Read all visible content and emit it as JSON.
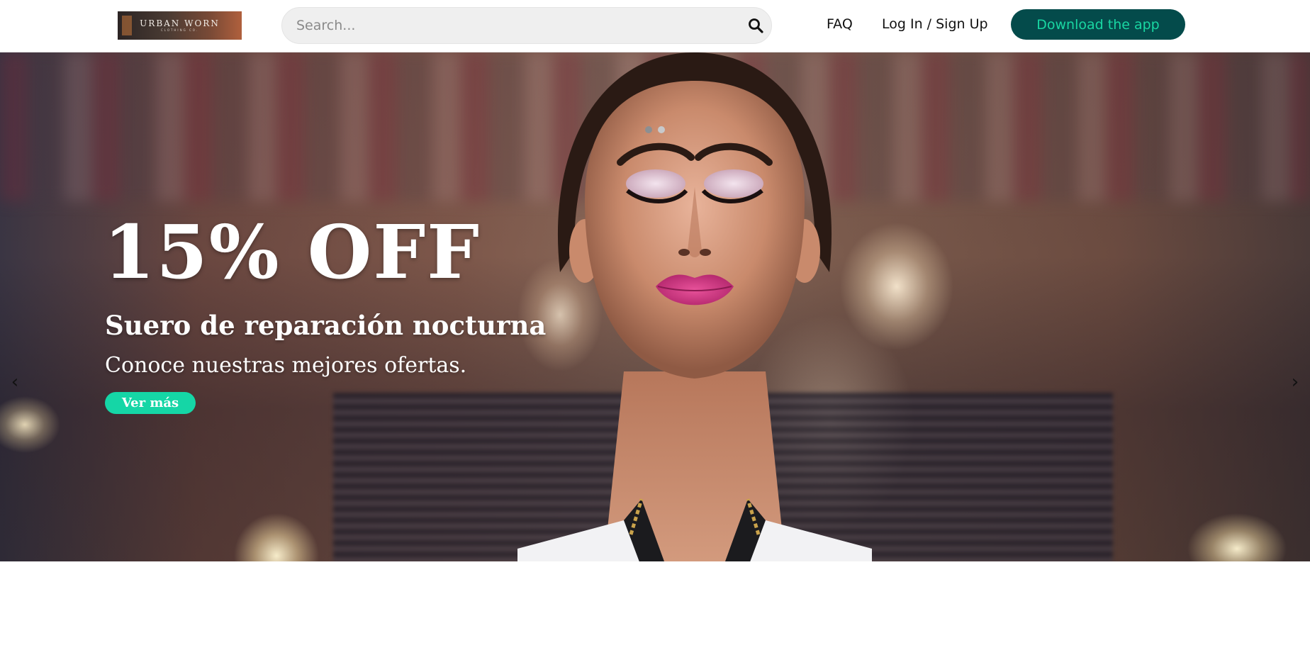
{
  "header": {
    "logo": {
      "text": "URBAN WORN",
      "subtext": "CLOTHING CO."
    },
    "search": {
      "placeholder": "Search...",
      "value": "",
      "icon": "search-icon"
    },
    "nav": {
      "faq_label": "FAQ",
      "login_label": "Log In / Sign Up"
    },
    "download_label": "Download the app",
    "colors": {
      "download_bg": "#044b4b",
      "download_text": "#19d6a2"
    }
  },
  "hero": {
    "title": "15% OFF",
    "subtitle": "Suero de reparación nocturna",
    "tagline": "Conoce nuestras mejores ofertas.",
    "cta_label": "Ver más",
    "prev_arrow": "‹",
    "next_arrow": "›",
    "slides_count": 2,
    "active_slide": 1,
    "colors": {
      "cta_bg": "#15d6a6"
    }
  }
}
